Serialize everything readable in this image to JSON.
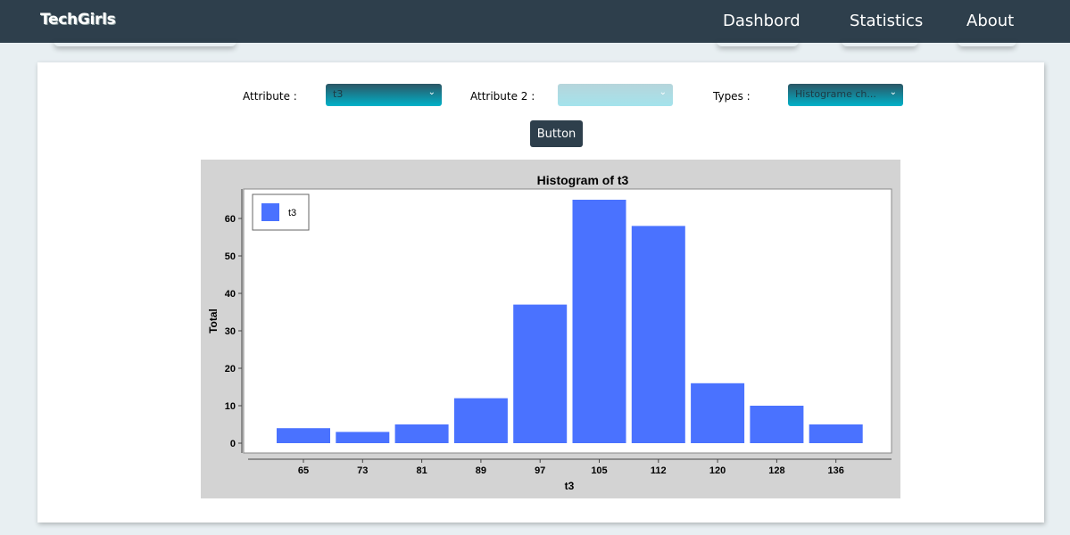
{
  "app": {
    "brand": "TechGirls"
  },
  "nav": {
    "items": [
      "Dashbord",
      "Statistics",
      "About"
    ]
  },
  "controls": {
    "attribute_label": "Attribute :",
    "attribute_value": "t3",
    "attribute2_label": "Attribute 2 :",
    "attribute2_value": "",
    "types_label": "Types :",
    "types_value": "Histograme ch...",
    "button_label": "Button"
  },
  "colors": {
    "topbar": "#2e3f4c",
    "bar": "#4a72ff",
    "chart_bg": "#d3d3d3"
  },
  "chart_data": {
    "type": "bar",
    "title": "Histogram of t3",
    "xlabel": "t3",
    "ylabel": "Total",
    "categories": [
      "65",
      "73",
      "81",
      "89",
      "97",
      "105",
      "112",
      "120",
      "128",
      "136"
    ],
    "series": [
      {
        "name": "t3",
        "values": [
          4,
          3,
          5,
          12,
          37,
          65,
          58,
          16,
          10,
          5
        ]
      }
    ],
    "yticks": [
      0,
      10,
      20,
      30,
      40,
      50,
      60
    ],
    "ylim": [
      0,
      65
    ],
    "legend": "top-left",
    "grid": false
  }
}
